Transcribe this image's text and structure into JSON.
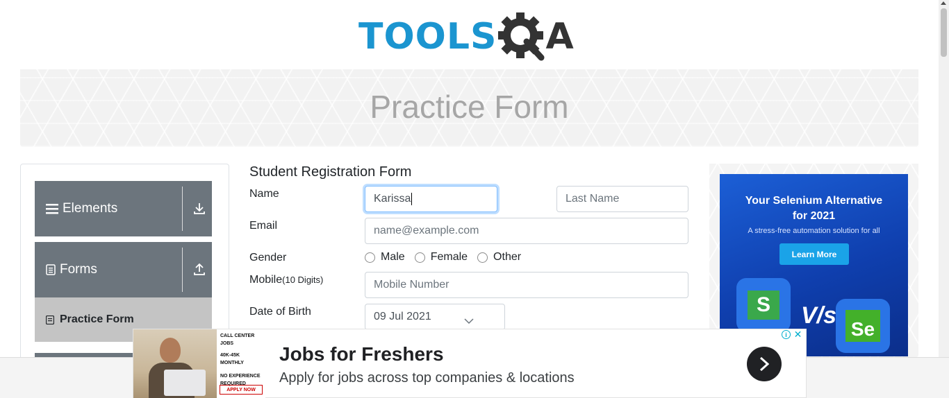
{
  "logo": {
    "word": "TOOLS",
    "suffix": "A"
  },
  "banner": {
    "title": "Practice Form"
  },
  "sidebar": {
    "groups": [
      {
        "label": "Elements",
        "icon": "hamburger-icon",
        "toggle_icon": "download-arrow-icon"
      },
      {
        "label": "Forms",
        "icon": "document-icon",
        "toggle_icon": "upload-arrow-icon"
      }
    ],
    "active_item": {
      "label": "Practice Form",
      "icon": "form-icon"
    }
  },
  "form": {
    "title": "Student Registration Form",
    "name_label": "Name",
    "first_name": {
      "value": "Karissa",
      "placeholder": "First Name"
    },
    "last_name": {
      "value": "",
      "placeholder": "Last Name"
    },
    "email_label": "Email",
    "email": {
      "value": "",
      "placeholder": "name@example.com"
    },
    "gender_label": "Gender",
    "gender_options": [
      "Male",
      "Female",
      "Other"
    ],
    "mobile_label": "Mobile",
    "mobile_hint": "(10 Digits)",
    "mobile": {
      "value": "",
      "placeholder": "Mobile Number"
    },
    "dob_label": "Date of Birth",
    "dob_value": "09 Jul 2021"
  },
  "right_ad": {
    "headline_1": "Your Selenium Alternative",
    "headline_2": "for 2021",
    "subtitle": "A stress-free automation solution for all",
    "cta": "Learn More",
    "vs": "V/s",
    "logo_left": "S",
    "logo_right": "Se",
    "colors": {
      "background": "#1546c2",
      "cta": "#1aa3e8"
    }
  },
  "bottom_ad": {
    "image_text": [
      "CALL CENTER JOBS",
      "40K-45K MONTHLY",
      "NO EXPERIENCE REQUIRED"
    ],
    "image_cta": "APPLY NOW",
    "title": "Jobs for Freshers",
    "description": "Apply for jobs across top companies & locations",
    "adchoices": "i",
    "close": "✕"
  },
  "colors": {
    "brand_blue": "#1b95d0",
    "sidebar_header": "#6c757d",
    "sidebar_active": "#c4c4c4",
    "focus": "#80bdff"
  }
}
